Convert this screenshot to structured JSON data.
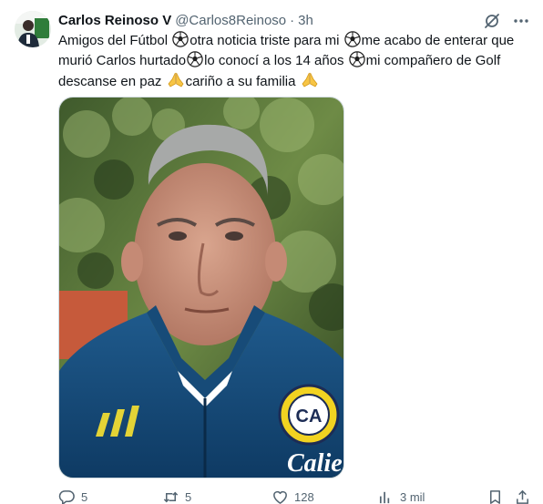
{
  "tweet": {
    "display_name": "Carlos Reinoso V",
    "handle": "@Carlos8Reinoso",
    "separator": "·",
    "time": "3h",
    "text_lines": [
      [
        "Amigos del Fútbol ",
        "ball",
        "otra noticia  triste para mi ",
        "ball",
        "me acabo de enterar que"
      ],
      [
        "murió Carlos hurtado",
        "ball",
        "lo conocí a los 14 años ",
        "ball",
        "mi compañero de Golf"
      ],
      [
        "descanse en paz ",
        "pray",
        "cariño a su familia ",
        "pray"
      ]
    ],
    "media_alt": "Selfie photo of a gray-haired man in a blue club jacket",
    "jacket_text": "Calien",
    "crest_text": "CA"
  },
  "actions": {
    "replies": "5",
    "retweets": "5",
    "likes": "128",
    "views": "3 mil"
  },
  "icons": {
    "grok": "grok-icon",
    "more": "more-icon",
    "reply": "reply-icon",
    "retweet": "retweet-icon",
    "like": "heart-icon",
    "views": "views-icon",
    "bookmark": "bookmark-icon",
    "share": "share-icon"
  },
  "colors": {
    "text": "#0f1419",
    "secondary": "#536471",
    "border": "#cfd9de"
  }
}
